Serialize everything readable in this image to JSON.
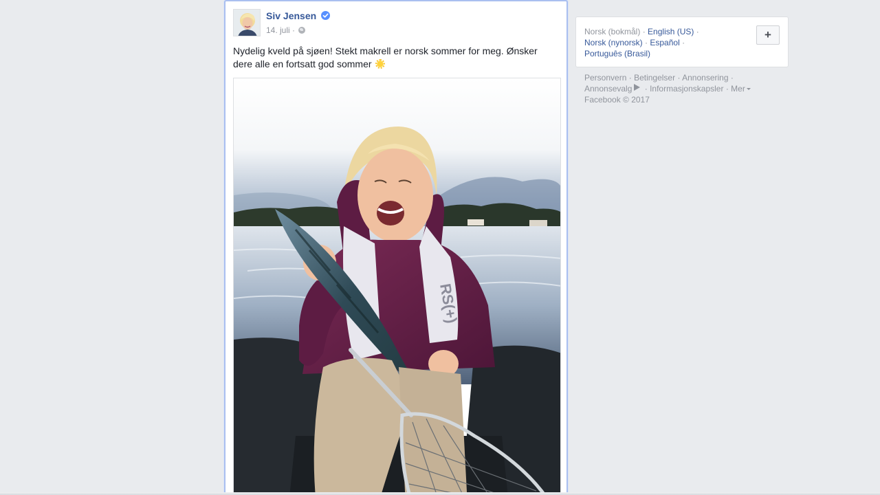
{
  "post": {
    "author": "Siv Jensen",
    "date": "14. juli",
    "date_separator": "·",
    "text": "Nydelig kveld på sjøen! Stekt makrell er norsk sommer for meg. Ønsker dere alle en fortsatt god sommer"
  },
  "languages": {
    "current": "Norsk (bokmål)",
    "items": [
      "English (US)",
      "Norsk (nynorsk)",
      "Español",
      "Português (Brasil)"
    ],
    "add_label": "+"
  },
  "footer": {
    "links": [
      "Personvern",
      "Betingelser",
      "Annonsering",
      "Annonsevalg",
      "Informasjonskapsler",
      "Mer"
    ],
    "copyright": "Facebook © 2017"
  },
  "icons": {
    "verified": "verified-badge-icon",
    "audience": "globe-icon",
    "emoji": "sun-emoji-icon",
    "adchoices": "adchoices-icon",
    "more": "caret-down-icon"
  },
  "colors": {
    "page_bg": "#e9ebee",
    "link": "#365899",
    "meta": "#90949c",
    "focus_border": "#a9bff0",
    "verified": "#5890ff"
  }
}
